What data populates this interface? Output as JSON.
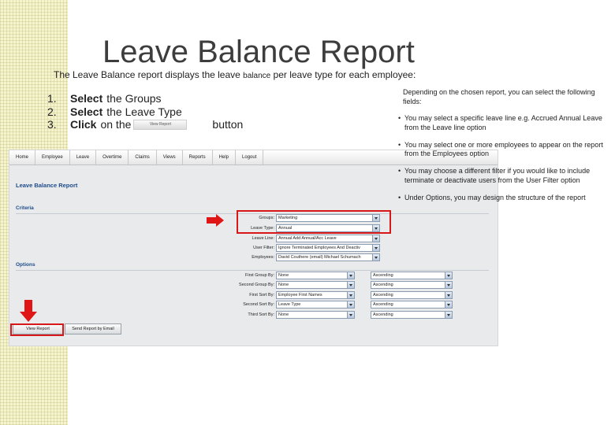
{
  "title": "Leave Balance Report",
  "subtitle": {
    "part1": "The Leave Balance report displays the leave ",
    "part2": "balance",
    "part3": " per leave type for each employee:"
  },
  "steps": [
    {
      "num": "1.",
      "verb": "Select",
      "text": "the Groups"
    },
    {
      "num": "2.",
      "verb": "Select",
      "text": "the Leave Type"
    },
    {
      "num": "3.",
      "verb": "Click",
      "text": "on the",
      "button_label": "View Report",
      "after": "button"
    }
  ],
  "notes": {
    "intro": "Depending on the chosen report, you can select the following fields:",
    "bullets": [
      "You may select a specific leave line e.g. Accrued Annual Leave from the Leave line option",
      "You may select one or more employees to appear on the report from the Employees option",
      "You may choose a different filter if you would like to include terminate or deactivate users from the User Filter option",
      "Under Options, you may design the structure of the report"
    ]
  },
  "screenshot": {
    "nav": [
      "Home",
      "Employee",
      "Leave",
      "Overtime",
      "Claims",
      "Views",
      "Reports",
      "Help",
      "Logout"
    ],
    "page_title": "Leave Balance Report",
    "criteria_label": "Criteria",
    "options_label": "Options",
    "criteria": [
      {
        "label": "Groups:",
        "value": "Marketing"
      },
      {
        "label": "Leave Type:",
        "value": "Annual"
      },
      {
        "label": "Leave Line:",
        "value": "Annual Add Annual/Acc Leave"
      },
      {
        "label": "User Filter:",
        "value": "Ignore Terminated Employees And Deactiv"
      },
      {
        "label": "Employees:",
        "value": "David Couthere (email) Michael Schumach"
      }
    ],
    "options": [
      {
        "label": "First Group By:",
        "value": "None",
        "order": "Ascending"
      },
      {
        "label": "Second Group By:",
        "value": "None",
        "order": "Ascending"
      },
      {
        "label": "First Sort By:",
        "value": "Employee First Names",
        "order": "Ascending"
      },
      {
        "label": "Second Sort By:",
        "value": "Leave Type",
        "order": "Ascending"
      },
      {
        "label": "Third Sort By:",
        "value": "None",
        "order": "Ascending"
      }
    ],
    "view_report_label": "View Report",
    "send_email_label": "Send Report by Email"
  },
  "colors": {
    "accent": "#1f4c8a",
    "highlight": "#d81818",
    "strip": "#f6f4cf"
  }
}
